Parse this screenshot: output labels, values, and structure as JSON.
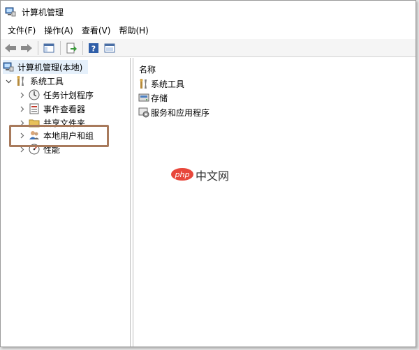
{
  "window": {
    "title": "计算机管理"
  },
  "menubar": {
    "items": [
      {
        "label": "文件(F)"
      },
      {
        "label": "操作(A)"
      },
      {
        "label": "查看(V)"
      },
      {
        "label": "帮助(H)"
      }
    ]
  },
  "toolbar": {
    "buttons": [
      "back-arrow-icon",
      "forward-arrow-icon",
      "show-hide-console-tree-icon",
      "export-list-icon",
      "help-icon",
      "properties-icon"
    ]
  },
  "tree": {
    "root": {
      "label": "计算机管理(本地)",
      "icon": "computer-management-icon"
    },
    "system_tools": {
      "label": "系统工具",
      "icon": "tools-icon",
      "expanded": true
    },
    "items": [
      {
        "label": "任务计划程序",
        "icon": "clock-icon"
      },
      {
        "label": "事件查看器",
        "icon": "event-viewer-icon"
      },
      {
        "label": "共享文件夹",
        "icon": "shared-folder-icon"
      },
      {
        "label": "本地用户和组",
        "icon": "users-icon",
        "highlighted": true
      },
      {
        "label": "性能",
        "icon": "performance-icon"
      }
    ]
  },
  "list": {
    "header": "名称",
    "items": [
      {
        "label": "系统工具",
        "icon": "tools-icon"
      },
      {
        "label": "存储",
        "icon": "storage-icon"
      },
      {
        "label": "服务和应用程序",
        "icon": "services-icon"
      }
    ]
  },
  "watermark": {
    "text": "中文网",
    "logo": "php"
  },
  "colors": {
    "highlight_border": "#a87a5c",
    "selection": "#e5f0fb",
    "watermark_accent": "#e8473b"
  }
}
